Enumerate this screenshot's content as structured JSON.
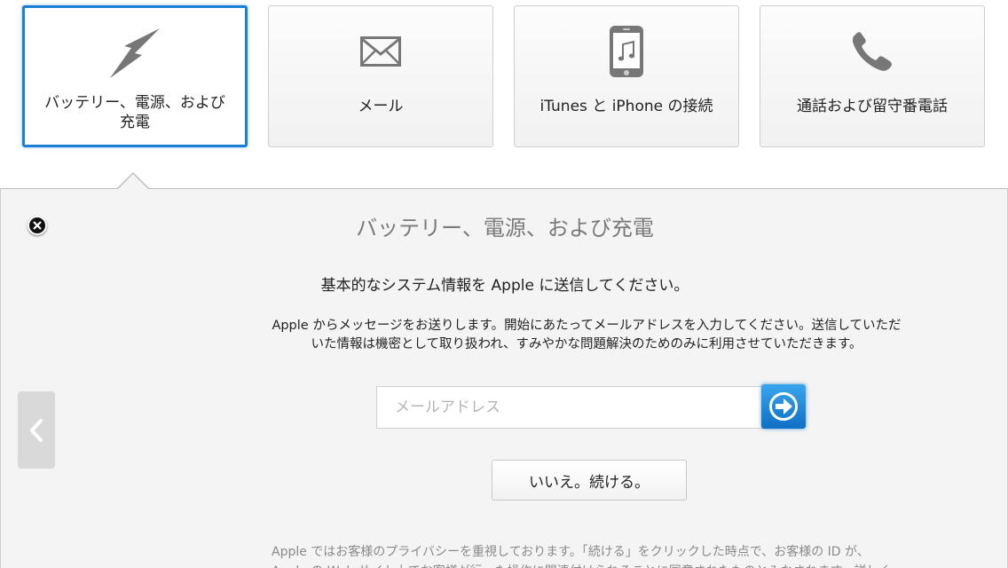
{
  "topics": {
    "items": [
      {
        "label": "バッテリー、電源、および充電",
        "icon": "lightning-bolt-icon",
        "selected": true
      },
      {
        "label": "メール",
        "icon": "envelope-icon",
        "selected": false
      },
      {
        "label": "iTunes と iPhone の接続",
        "icon": "iphone-music-icon",
        "selected": false
      },
      {
        "label": "通話および留守番電話",
        "icon": "phone-handset-icon",
        "selected": false
      }
    ]
  },
  "panel": {
    "title": "バッテリー、電源、および充電",
    "subtitle": "基本的なシステム情報を Apple に送信してください。",
    "body": "Apple からメッセージをお送りします。開始にあたってメールアドレスを入力してください。送信していただいた情報は機密として取り扱われ、すみやかな問題解決のためのみに利用させていただきます。",
    "email_placeholder": "メールアドレス",
    "continue_label": "いいえ。続ける。",
    "privacy": "Apple ではお客様のプライバシーを重視しております。「続ける」をクリックした時点で、お客様の ID が、\nApple の Web サイト上でお客様が行った操作に関連付けられることに同意されたものとみなされます。詳しく"
  },
  "colors": {
    "selected_border": "#1b7fd6",
    "submit_button": "#1b7fd6",
    "panel_background": "#f4f4f4",
    "icon_gray": "#777777"
  }
}
